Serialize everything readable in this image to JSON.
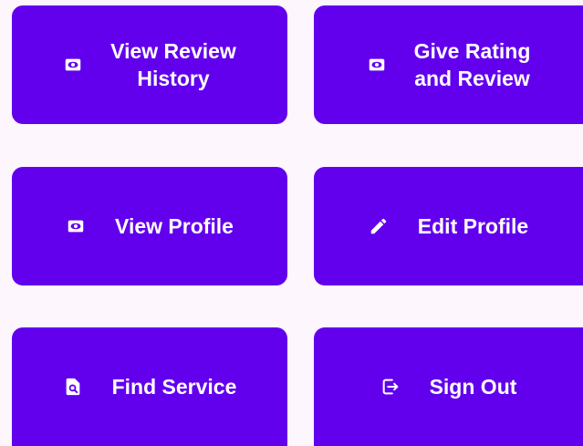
{
  "theme": {
    "background": "#fdf6fd",
    "tile_color": "#6200ee",
    "text_color": "#ffffff"
  },
  "tiles": [
    {
      "label": "View Review\nHistory",
      "icon": "eye-card-icon"
    },
    {
      "label": "Give Rating\nand Review",
      "icon": "eye-card-icon"
    },
    {
      "label": "View Profile",
      "icon": "eye-card-icon"
    },
    {
      "label": "Edit Profile",
      "icon": "pencil-icon"
    },
    {
      "label": "Find Service",
      "icon": "file-search-icon"
    },
    {
      "label": "Sign Out",
      "icon": "exit-icon"
    }
  ]
}
